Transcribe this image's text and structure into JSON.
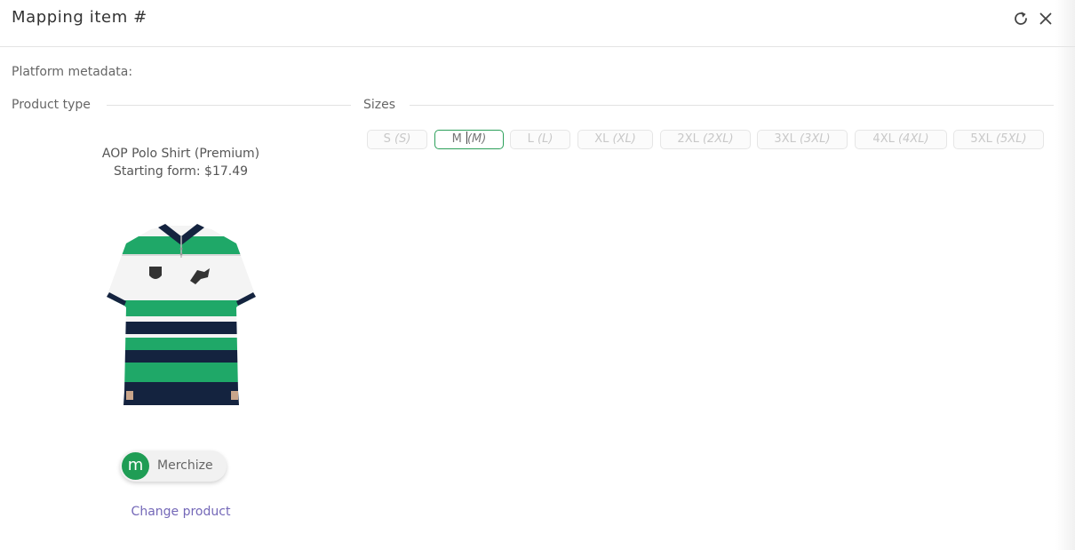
{
  "header": {
    "title": "Mapping item #",
    "refresh_icon": "refresh-icon",
    "close_icon": "close-icon"
  },
  "platform_metadata_label": "Platform metadata:",
  "product_type": {
    "section_label": "Product type",
    "product_name": "AOP Polo Shirt (Premium)",
    "starting_price": "Starting form: $17.49",
    "vendor": {
      "name": "Merchize",
      "logo_text": "m",
      "logo_color": "#1f9d55"
    },
    "change_product_label": "Change product"
  },
  "sizes": {
    "section_label": "Sizes",
    "selected": "M",
    "items": [
      {
        "size": "S",
        "alias": "(S)"
      },
      {
        "size": "M",
        "alias": "(M)"
      },
      {
        "size": "L",
        "alias": "(L)"
      },
      {
        "size": "XL",
        "alias": "(XL)"
      },
      {
        "size": "2XL",
        "alias": "(2XL)"
      },
      {
        "size": "3XL",
        "alias": "(3XL)"
      },
      {
        "size": "4XL",
        "alias": "(4XL)"
      },
      {
        "size": "5XL",
        "alias": "(5XL)"
      }
    ]
  },
  "colors": {
    "accent_green": "#2ca05a",
    "link": "#7468b8",
    "shirt_green": "#1fa868",
    "shirt_navy": "#14233f"
  }
}
